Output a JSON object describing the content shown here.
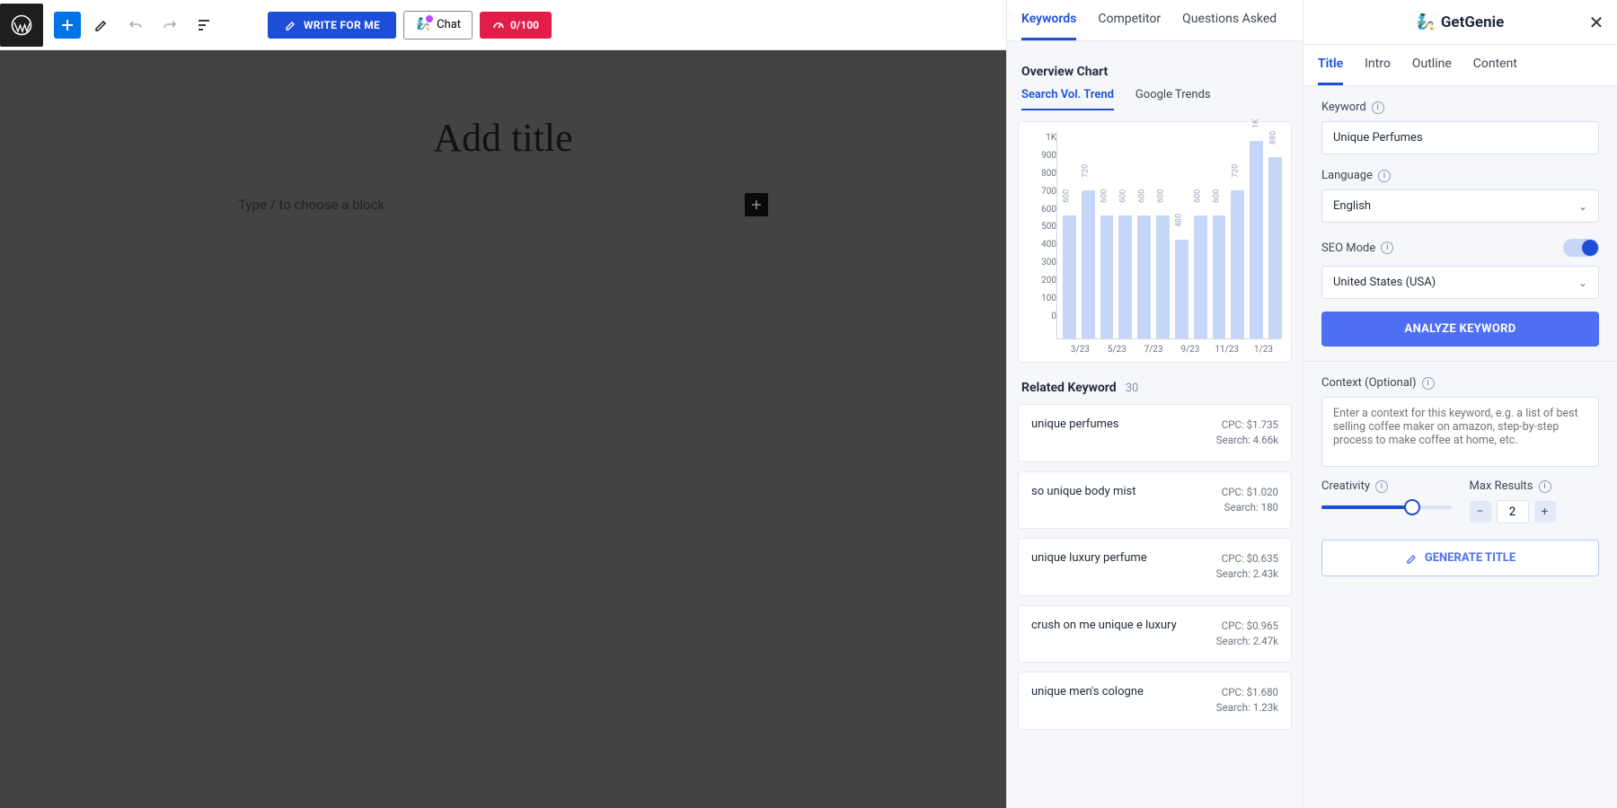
{
  "toolbar": {
    "write_label": "WRITE FOR ME",
    "chat_label": "Chat",
    "score_label": "0/100"
  },
  "editor": {
    "title_placeholder": "Add title",
    "block_placeholder": "Type / to choose a block"
  },
  "kw_panel": {
    "tabs": [
      "Keywords",
      "Competitor",
      "Questions Asked"
    ],
    "active_tab": 0,
    "overview_title": "Overview Chart",
    "subtabs": [
      "Search Vol. Trend",
      "Google Trends"
    ],
    "active_subtab": 0,
    "related_title": "Related Keyword",
    "related_count": "30",
    "related": [
      {
        "kw": "unique perfumes",
        "cpc": "CPC: $1.735",
        "search": "Search: 4.66k"
      },
      {
        "kw": "so unique body mist",
        "cpc": "CPC: $1.020",
        "search": "Search: 180"
      },
      {
        "kw": "unique luxury perfume",
        "cpc": "CPC: $0.635",
        "search": "Search: 2.43k"
      },
      {
        "kw": "crush on me unique e luxury",
        "cpc": "CPC: $0.965",
        "search": "Search: 2.47k"
      },
      {
        "kw": "unique men's cologne",
        "cpc": "CPC: $1.680",
        "search": "Search: 1.23k"
      }
    ]
  },
  "chart_data": {
    "type": "bar",
    "categories": [
      "3/23",
      "",
      "5/23",
      "",
      "7/23",
      "",
      "9/23",
      "",
      "11/23",
      "",
      "1/23",
      ""
    ],
    "values": [
      600,
      720,
      600,
      600,
      600,
      600,
      480,
      600,
      600,
      720,
      960,
      880
    ],
    "value_labels": [
      "600",
      "720",
      "600",
      "600",
      "600",
      "600",
      "480",
      "600",
      "600",
      "720",
      "1K",
      "880"
    ],
    "ylabel": "",
    "xlabel": "",
    "ylim": [
      0,
      1000
    ],
    "yticks": [
      "1K",
      "900",
      "800",
      "700",
      "600",
      "500",
      "400",
      "300",
      "200",
      "100",
      "0"
    ]
  },
  "gen_panel": {
    "logo": "GetGenie",
    "tabs": [
      "Title",
      "Intro",
      "Outline",
      "Content"
    ],
    "active_tab": 0,
    "keyword_label": "Keyword",
    "keyword_value": "Unique Perfumes",
    "language_label": "Language",
    "language_value": "English",
    "seo_mode_label": "SEO Mode",
    "country_value": "United States (USA)",
    "analyze_label": "ANALYZE KEYWORD",
    "context_label": "Context (Optional)",
    "context_placeholder": "Enter a context for this keyword, e.g. a list of best selling coffee maker on amazon, step-by-step process to make coffee at home, etc.",
    "creativity_label": "Creativity",
    "max_results_label": "Max Results",
    "max_results_value": "2",
    "generate_label": "GENERATE TITLE"
  }
}
